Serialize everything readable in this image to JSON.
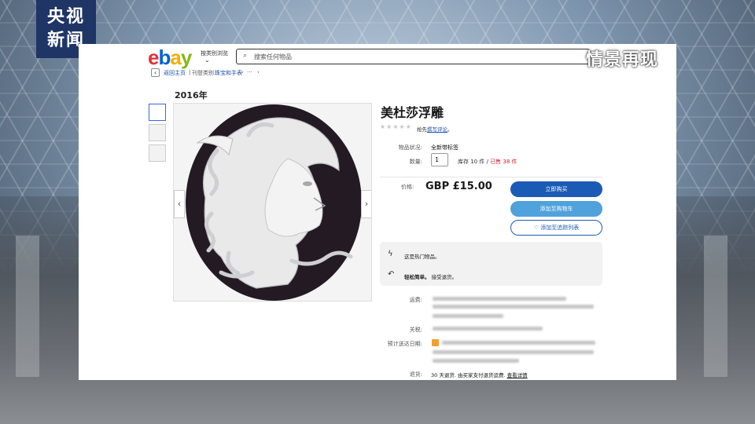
{
  "overlay": {
    "logo_line1": "央视",
    "logo_line2": "新闻",
    "caption": "情景再现"
  },
  "header": {
    "category_browse": "按类别浏览",
    "chevron": "⌄",
    "search_icon": "⌕",
    "search_placeholder": "搜索任何物品"
  },
  "breadcrumb": {
    "back_icon": "‹",
    "items": [
      "返回主页",
      "刊登类别:",
      "珠宝和手表",
      "›",
      "···",
      "›"
    ]
  },
  "listing": {
    "year": "2016年",
    "title": "美杜莎浮雕",
    "stars": "★★★★★",
    "review_prefix": "抢先",
    "review_link": "撰写评论",
    "review_suffix": "。",
    "condition_label": "物品状况:",
    "condition_value": "全新带标签",
    "quantity_label": "数量:",
    "quantity_value": "1",
    "stock_text": "库存 10 件 /",
    "sold_text": "已售 38 件",
    "price_label": "价格:",
    "price": "GBP £15.00",
    "buy_now": "立即购买",
    "add_to_cart": "添加至购物车",
    "watch_icon": "♡",
    "watch": "添加至追踪列表",
    "promo1_icon": "ϟ",
    "promo1": "这是热门物品。",
    "promo2_icon": "↶",
    "promo2": "轻松简单。",
    "promo2_tail": "接受退货。",
    "shipping_label": "运费:",
    "customs_label": "关税:",
    "delivery_label": "预计送达日期:",
    "returns_label": "退货:",
    "returns_text": "30 天退货. 由买家支付退货运费.",
    "returns_link": "查看详情"
  },
  "image_nav": {
    "prev": "‹",
    "next": "›"
  },
  "colors": {
    "ebay_e": "#e53238",
    "ebay_b": "#0064d2",
    "ebay_a": "#f5af02",
    "ebay_y": "#86b817",
    "buy_button": "#1c5bb5",
    "cart_button": "#4fa2dc",
    "link": "#1c4fa8",
    "sold": "#d3212c"
  }
}
